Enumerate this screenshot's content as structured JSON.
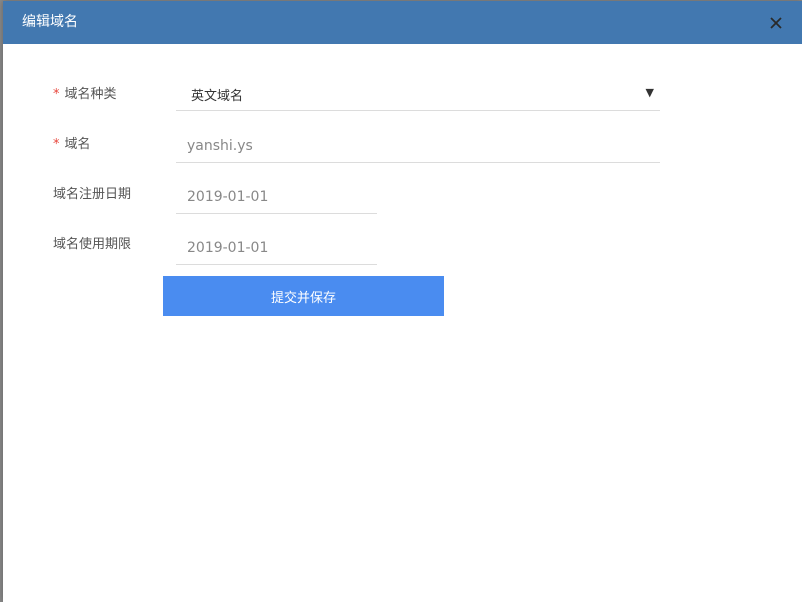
{
  "dialog": {
    "title": "编辑域名"
  },
  "form": {
    "required_mark": "*",
    "domain_type": {
      "label": "域名种类",
      "value": "英文域名"
    },
    "domain": {
      "label": "域名",
      "value": "yanshi.ys"
    },
    "register_date": {
      "label": "域名注册日期",
      "value": "2019-01-01"
    },
    "expire_date": {
      "label": "域名使用期限",
      "value": "2019-01-01"
    },
    "submit_label": "提交并保存"
  },
  "icons": {
    "close": "close-icon",
    "dropdown": "caret-down-icon"
  },
  "colors": {
    "titlebar": "#4278b0",
    "button": "#4a8cf0",
    "required": "#e8463c"
  }
}
